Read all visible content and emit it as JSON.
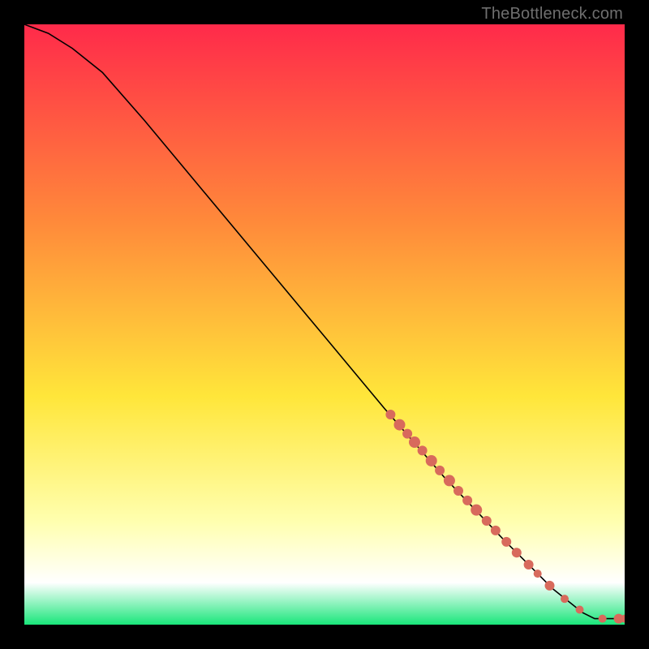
{
  "attribution": "TheBottleneck.com",
  "colors": {
    "bg_black": "#000000",
    "top_red": "#ff2a4a",
    "mid_orange": "#ff8a3a",
    "mid_yellow": "#ffe63a",
    "pale_yellow": "#ffffb0",
    "near_white": "#ffffff",
    "bottom_green": "#19e67a",
    "curve_stroke": "#000000",
    "dot_fill": "#d86a5c"
  },
  "chart_data": {
    "type": "line",
    "title": "",
    "xlabel": "",
    "ylabel": "",
    "xlim": [
      0,
      100
    ],
    "ylim": [
      0,
      100
    ],
    "curve": {
      "comment": "Monotone curve from top-left to bottom-right; x,y in 0..100 plot-normalized units (origin bottom-left).",
      "points": [
        {
          "x": 0,
          "y": 100
        },
        {
          "x": 4,
          "y": 98.5
        },
        {
          "x": 8,
          "y": 96
        },
        {
          "x": 13,
          "y": 92
        },
        {
          "x": 20,
          "y": 84
        },
        {
          "x": 30,
          "y": 72
        },
        {
          "x": 40,
          "y": 60
        },
        {
          "x": 50,
          "y": 48
        },
        {
          "x": 60,
          "y": 36
        },
        {
          "x": 70,
          "y": 24.5
        },
        {
          "x": 80,
          "y": 14
        },
        {
          "x": 88,
          "y": 6
        },
        {
          "x": 93,
          "y": 2
        },
        {
          "x": 95,
          "y": 1
        },
        {
          "x": 97,
          "y": 1
        },
        {
          "x": 100,
          "y": 1
        }
      ]
    },
    "dots": {
      "comment": "Salmon dots clustered on the lower-right of the curve; x,y in 0..100, r in plot px.",
      "points": [
        {
          "x": 61.0,
          "y": 35.0,
          "r": 6
        },
        {
          "x": 62.5,
          "y": 33.3,
          "r": 7
        },
        {
          "x": 63.8,
          "y": 31.8,
          "r": 6
        },
        {
          "x": 65.0,
          "y": 30.4,
          "r": 7
        },
        {
          "x": 66.3,
          "y": 29.0,
          "r": 6
        },
        {
          "x": 67.8,
          "y": 27.3,
          "r": 7
        },
        {
          "x": 69.2,
          "y": 25.7,
          "r": 6
        },
        {
          "x": 70.8,
          "y": 24.0,
          "r": 7
        },
        {
          "x": 72.3,
          "y": 22.3,
          "r": 6
        },
        {
          "x": 73.8,
          "y": 20.7,
          "r": 6
        },
        {
          "x": 75.3,
          "y": 19.1,
          "r": 7
        },
        {
          "x": 77.0,
          "y": 17.3,
          "r": 6
        },
        {
          "x": 78.5,
          "y": 15.7,
          "r": 6
        },
        {
          "x": 80.3,
          "y": 13.8,
          "r": 6
        },
        {
          "x": 82.0,
          "y": 12.0,
          "r": 6
        },
        {
          "x": 84.0,
          "y": 10.0,
          "r": 6
        },
        {
          "x": 85.5,
          "y": 8.5,
          "r": 5
        },
        {
          "x": 87.5,
          "y": 6.5,
          "r": 6
        },
        {
          "x": 90.0,
          "y": 4.3,
          "r": 5
        },
        {
          "x": 92.5,
          "y": 2.5,
          "r": 5
        },
        {
          "x": 96.3,
          "y": 1.0,
          "r": 5
        },
        {
          "x": 99.0,
          "y": 1.0,
          "r": 6
        },
        {
          "x": 100.0,
          "y": 1.0,
          "r": 5
        }
      ]
    },
    "gradient_stops": [
      {
        "offset": 0.0,
        "key": "top_red"
      },
      {
        "offset": 0.33,
        "key": "mid_orange"
      },
      {
        "offset": 0.62,
        "key": "mid_yellow"
      },
      {
        "offset": 0.83,
        "key": "pale_yellow"
      },
      {
        "offset": 0.93,
        "key": "near_white"
      },
      {
        "offset": 1.0,
        "key": "bottom_green"
      }
    ]
  }
}
